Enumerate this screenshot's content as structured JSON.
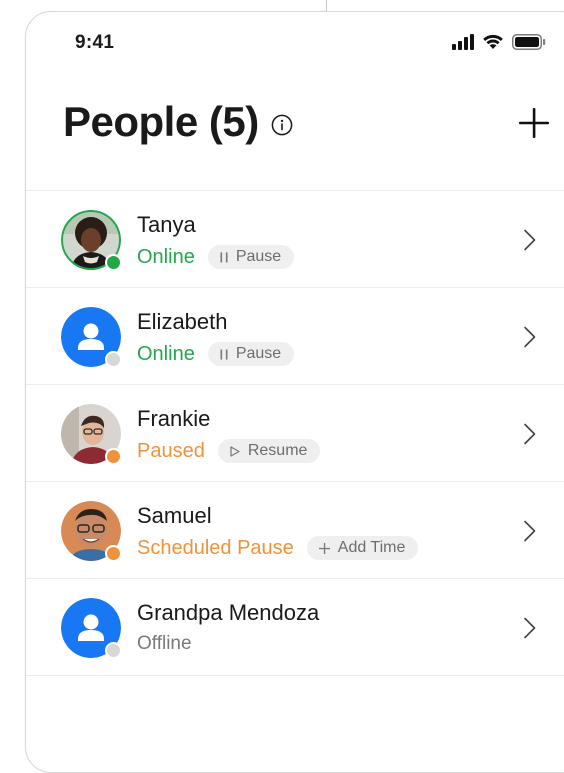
{
  "status_bar": {
    "time": "9:41"
  },
  "header": {
    "title": "People (5)"
  },
  "colors": {
    "online": "#22a84a",
    "paused": "#f0923c",
    "offline": "#7a7a7a",
    "avatar_blue": "#1877f2",
    "dot_offline": "#d8d8d8"
  },
  "people": [
    {
      "name": "Tanya",
      "status": "Online",
      "status_kind": "online",
      "action": "Pause",
      "action_icon": "pause-icon",
      "avatar": "photo-tanya"
    },
    {
      "name": "Elizabeth",
      "status": "Online",
      "status_kind": "online",
      "action": "Pause",
      "action_icon": "pause-icon",
      "avatar": "placeholder-user"
    },
    {
      "name": "Frankie",
      "status": "Paused",
      "status_kind": "paused",
      "action": "Resume",
      "action_icon": "play-icon",
      "avatar": "photo-frankie"
    },
    {
      "name": "Samuel",
      "status": "Scheduled Pause",
      "status_kind": "paused",
      "action": "Add Time",
      "action_icon": "plus-icon",
      "avatar": "photo-samuel"
    },
    {
      "name": "Grandpa Mendoza",
      "status": "Offline",
      "status_kind": "offline",
      "action": "",
      "action_icon": "",
      "avatar": "placeholder-user"
    }
  ]
}
